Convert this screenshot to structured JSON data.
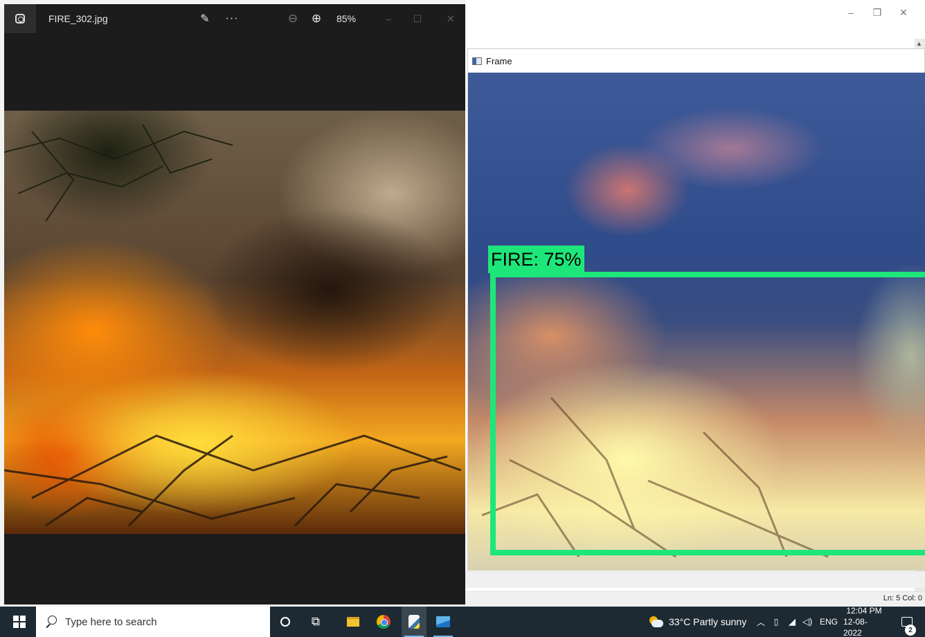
{
  "photos_app": {
    "file_name": "FIRE_302.jpg",
    "zoom_level": "85%",
    "icons": {
      "app": "photos-app-icon",
      "edit": "edit-image-icon",
      "more": "ellipsis-icon",
      "zoom_out": "zoom-out-icon",
      "zoom_in": "zoom-in-icon"
    },
    "window_controls": {
      "minimize": "–",
      "maximize": "☐",
      "close": "✕"
    }
  },
  "frame_window": {
    "title": "Frame",
    "detection_label": "FIRE: 75%",
    "detection_color": "#1de77a"
  },
  "outer_window_controls": {
    "minimize": "–",
    "restore": "❐",
    "close": "✕"
  },
  "editor_status": {
    "position": "Ln: 5  Col: 0"
  },
  "taskbar": {
    "search_placeholder": "Type here to search",
    "weather": "33°C  Partly sunny",
    "language": "ENG",
    "time": "12:04 PM",
    "date": "12-08-2022",
    "notification_count": "2",
    "apps": [
      "cortana",
      "task-view",
      "file-explorer",
      "chrome",
      "python-idle",
      "photos"
    ]
  },
  "colors": {
    "photos_bg": "#1c1c1c",
    "taskbar_bg": "#1e2a33",
    "detection_box": "#1de77a"
  }
}
